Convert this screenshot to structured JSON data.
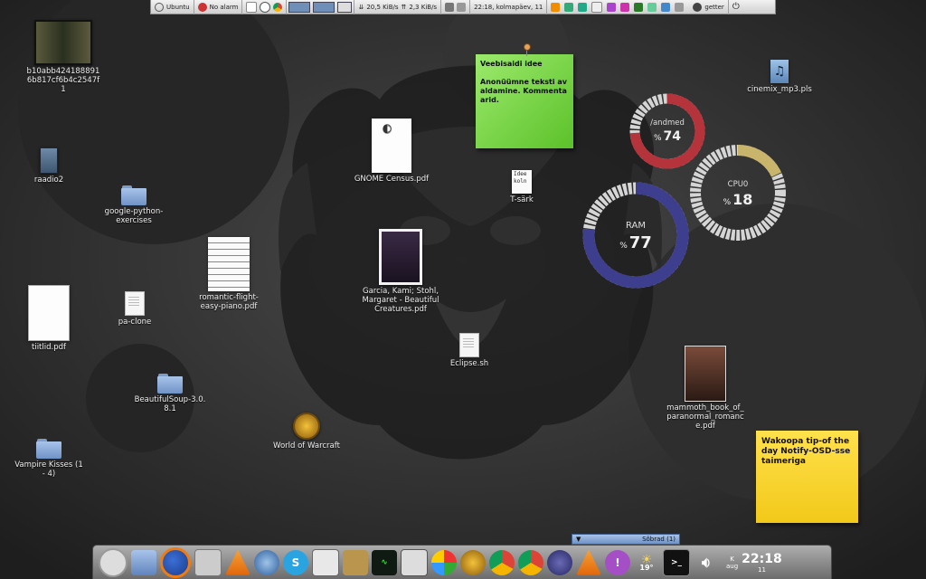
{
  "top_panel": {
    "distro_label": "Ubuntu",
    "alarm_label": "No alarm",
    "net_down": "20,5 KiB/s",
    "net_up": "2,3 KiB/s",
    "datetime": "22:18, kolmapäev, 11",
    "user_label": "getter"
  },
  "desktop_icons": {
    "video_file": "b10abb4241888916b817cf6b4c2547f1",
    "radio": "raadio2",
    "google_python": "google-python-exercises",
    "romantic_pdf": "romantic-flight-easy-piano.pdf",
    "tiitlid": "tiitlid.pdf",
    "pa_clone": "pa-clone",
    "beautifulsoup": "BeautifulSoup-3.0.8.1",
    "wow": "World of Warcraft",
    "vampire": "Vampire Kisses (1 - 4)",
    "gnome_census": "GNOME Census.pdf",
    "tsark": "T-särk",
    "tsark_thumb_text": "Idee koln",
    "beautiful_creatures": "Garcia, Kami; Stohl, Margaret - Beautiful Creatures.pdf",
    "eclipse": "Eclipse.sh",
    "cinemix": "cinemix_mp3.pls",
    "mammoth": "mammoth_book_of_paranormal_romance.pdf"
  },
  "notes": {
    "green_title": "Veebisaidi idee",
    "green_body": "Anonüümne teksti avaldamine. Kommentaarid.",
    "yellow_body": "Wakoopa tip-of the day Notify-OSD-sse taimeriga"
  },
  "gauges": [
    {
      "id": "disk",
      "label": "/andmed",
      "value": 74,
      "unit": "%",
      "color": "#b5333a"
    },
    {
      "id": "cpu",
      "label": "CPU0",
      "value": 18,
      "unit": "%",
      "color": "#c8b46a"
    },
    {
      "id": "ram",
      "label": "RAM",
      "value": 77,
      "unit": "%",
      "color": "#3d3f8e"
    }
  ],
  "dock": {
    "friends_label": "Sõbrad (1)",
    "weather_temp": "19°",
    "clock_time": "22:18",
    "clock_day": "K",
    "clock_month": "aug",
    "clock_date": "11"
  }
}
